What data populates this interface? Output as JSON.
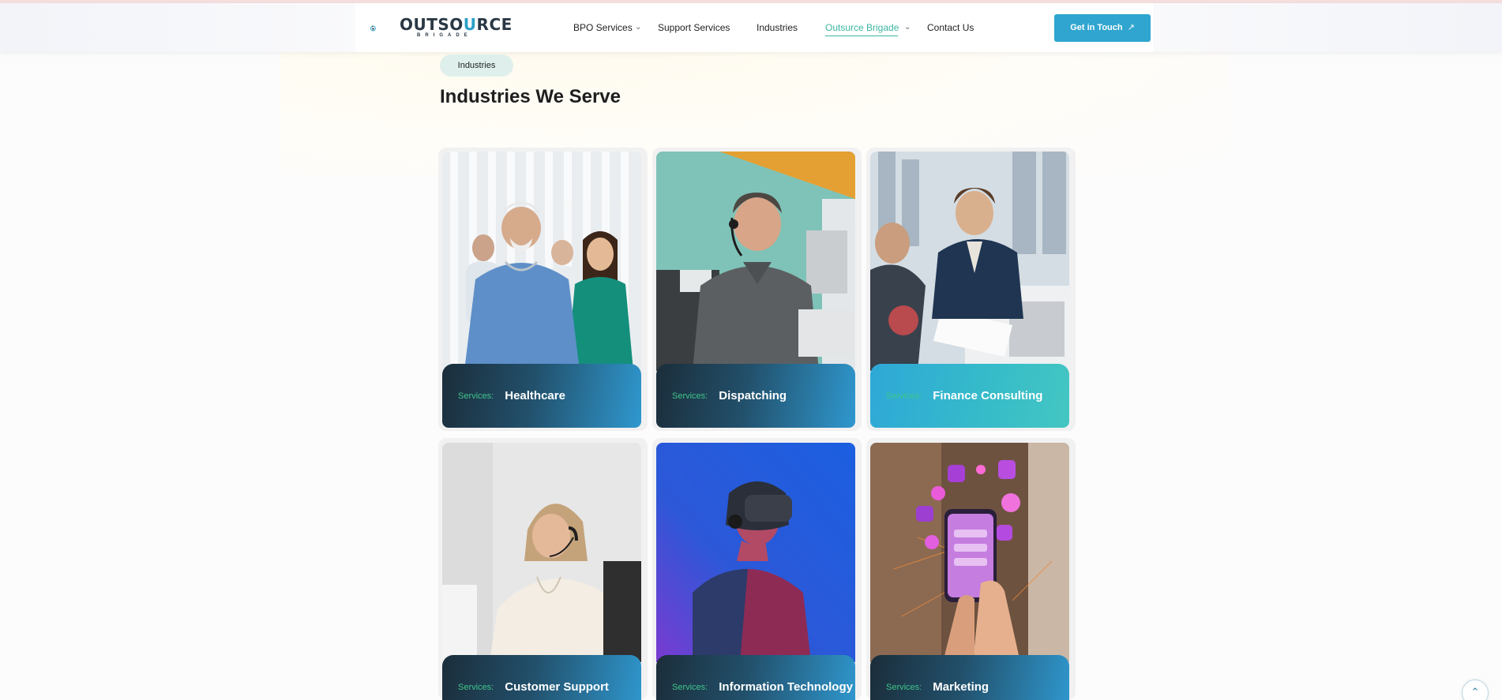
{
  "header": {
    "logo": {
      "brand_a": "OUTSO",
      "brand_b": "U",
      "brand_c": "RCE",
      "sub": "BRIGADE"
    },
    "nav": [
      {
        "label": "BPO Services",
        "has_dropdown": true
      },
      {
        "label": "Support Services",
        "has_dropdown": false
      },
      {
        "label": "Industries",
        "has_dropdown": false
      },
      {
        "label": "Outsurce Brigade",
        "has_dropdown": true,
        "active": true
      },
      {
        "label": "Contact Us",
        "has_dropdown": false
      }
    ],
    "cta_label": "Get in Touch"
  },
  "section": {
    "tag": "Industries",
    "title": "Industries We Serve"
  },
  "cards": [
    {
      "label_small": "Services:",
      "label": "Healthcare"
    },
    {
      "label_small": "Services:",
      "label": "Dispatching"
    },
    {
      "label_small": "Services:",
      "label": "Finance Consulting"
    },
    {
      "label_small": "Services:",
      "label": "Customer Support"
    },
    {
      "label_small": "Services:",
      "label": "Information Technology"
    },
    {
      "label_small": "Services:",
      "label": "Marketing"
    }
  ],
  "colors": {
    "brand": "#2fa5cf",
    "active_nav": "#3ab7a0",
    "services_label": "#3fc58a",
    "pill_bg": "#dff0ec"
  },
  "icons": [
    "chevron-down-icon",
    "arrow-up-right-icon",
    "chevron-up-icon"
  ]
}
